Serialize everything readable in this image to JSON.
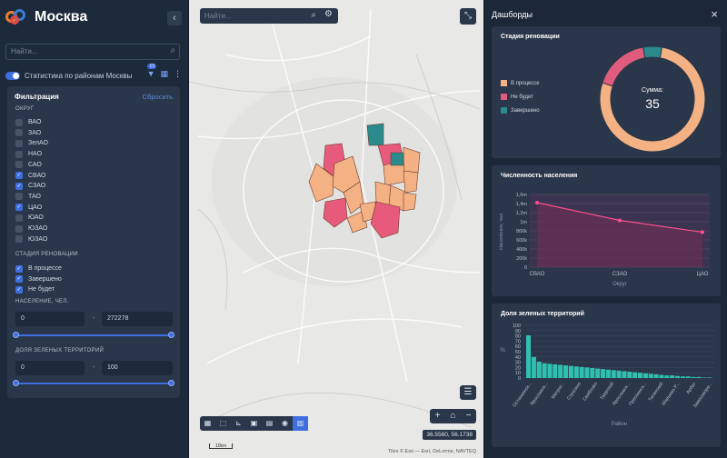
{
  "app": {
    "title": "Москва"
  },
  "left": {
    "search_placeholder": "Найти...",
    "layer_name": "Статистика по районам Москвы",
    "layer_badge": "13",
    "filter_title": "Фильтрация",
    "reset_label": "Сбросить",
    "district_label": "ОКРУГ",
    "districts": [
      {
        "label": "ВАО",
        "checked": false
      },
      {
        "label": "ЗАО",
        "checked": false
      },
      {
        "label": "ЗелАО",
        "checked": false
      },
      {
        "label": "НАО",
        "checked": false
      },
      {
        "label": "САО",
        "checked": false
      },
      {
        "label": "СВАО",
        "checked": true
      },
      {
        "label": "СЗАО",
        "checked": true
      },
      {
        "label": "ТАО",
        "checked": false
      },
      {
        "label": "ЦАО",
        "checked": true
      },
      {
        "label": "ЮАО",
        "checked": false
      },
      {
        "label": "ЮЗАО",
        "checked": false
      },
      {
        "label": "ЮЗАО",
        "checked": false
      }
    ],
    "stage_label": "СТАДИЯ РЕНОВАЦИИ",
    "stages": [
      {
        "label": "В процессе",
        "checked": true
      },
      {
        "label": "Завершено",
        "checked": true
      },
      {
        "label": "Не будет",
        "checked": true
      }
    ],
    "population_label": "НАСЕЛЕНИЕ, ЧЕЛ.",
    "population_min": "0",
    "population_max": "272278",
    "green_label": "ДОЛЯ ЗЕЛЕНЫХ ТЕРРИТОРИЙ",
    "green_min": "0",
    "green_max": "100"
  },
  "map": {
    "search_placeholder": "Найти...",
    "coords": "36.5560, 56.1738",
    "scale": "10km",
    "attribution": "Tiles © Esri — Esri, DeLorme, NAVTEQ"
  },
  "dashboard": {
    "title": "Дашборды",
    "donut": {
      "title": "Стадия реновации",
      "sum_label": "Сумма:",
      "sum_value": "35"
    },
    "line": {
      "title": "Численность населения"
    },
    "bar": {
      "title": "Доля зеленых территорий"
    }
  },
  "chart_data": [
    {
      "type": "pie",
      "title": "Стадия реновации",
      "categories": [
        "В процессе",
        "Не будет",
        "Завершено"
      ],
      "values": [
        27,
        6,
        2
      ],
      "colors": [
        "#f4b183",
        "#e05c7c",
        "#2a8a8c"
      ]
    },
    {
      "type": "line",
      "title": "Численность населения",
      "xlabel": "Округ",
      "ylabel": "Население, чел.",
      "categories": [
        "СВАО",
        "СЗАО",
        "ЦАО"
      ],
      "values": [
        1420000,
        1030000,
        770000
      ],
      "ylim": [
        0,
        1600000
      ],
      "yticks": [
        "0",
        "200k",
        "400k",
        "600k",
        "800k",
        "1m",
        "1,2m",
        "1,4m",
        "1,6m"
      ]
    },
    {
      "type": "bar",
      "title": "Доля зеленых территорий",
      "xlabel": "Район",
      "ylabel": "%",
      "ylim": [
        0,
        100
      ],
      "yticks": [
        "0",
        "10",
        "20",
        "30",
        "40",
        "50",
        "60",
        "70",
        "80",
        "90",
        "100"
      ],
      "xticks": [
        "Останкинск...",
        "Ярославск...",
        "Метрог...",
        "Строгино",
        "Свиблово",
        "Тверской",
        "Ярославск...",
        "Преснинск...",
        "Таганский",
        "Марьина Р...",
        "Арбат",
        "Замоскворе..."
      ],
      "values": [
        81,
        40,
        31,
        28,
        27,
        26,
        25,
        24,
        23,
        22,
        21,
        20,
        19,
        18,
        17,
        16,
        15,
        14,
        13,
        12,
        11,
        10,
        9,
        8,
        7,
        6,
        5,
        5,
        4,
        3,
        3,
        2,
        2,
        1,
        1
      ]
    }
  ]
}
